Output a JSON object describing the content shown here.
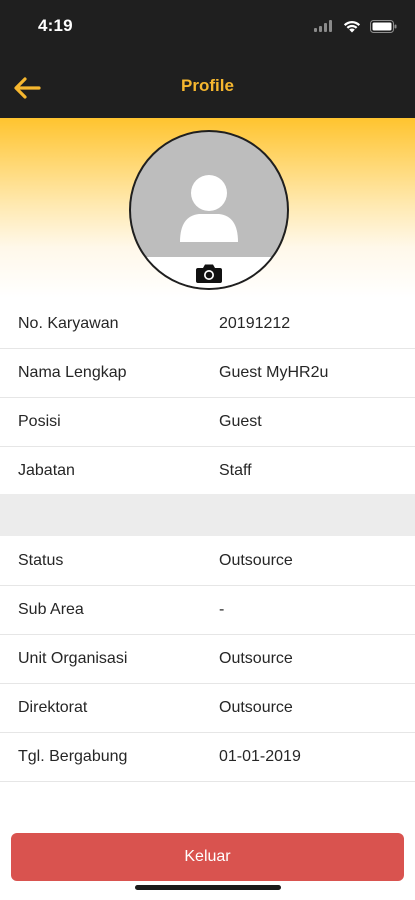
{
  "status_bar": {
    "time": "4:19",
    "icons": [
      "signal-icon",
      "wifi-icon",
      "battery-icon"
    ]
  },
  "nav": {
    "title": "Profile",
    "back_icon": "arrow-left-icon",
    "accent_color": "#f6b72f"
  },
  "profile": {
    "avatar_icon": "person-placeholder-icon",
    "camera_icon": "camera-icon"
  },
  "section_1": {
    "rows": [
      {
        "label": "No. Karyawan",
        "value": "20191212"
      },
      {
        "label": "Nama Lengkap",
        "value": "Guest MyHR2u"
      },
      {
        "label": "Posisi",
        "value": "Guest"
      },
      {
        "label": "Jabatan",
        "value": "Staff"
      }
    ]
  },
  "section_2": {
    "rows": [
      {
        "label": "Status",
        "value": "Outsource"
      },
      {
        "label": "Sub Area",
        "value": "-"
      },
      {
        "label": "Unit Organisasi",
        "value": "Outsource"
      },
      {
        "label": "Direktorat",
        "value": "Outsource"
      },
      {
        "label": "Tgl. Bergabung",
        "value": "01-01-2019"
      }
    ]
  },
  "logout": {
    "label": "Keluar",
    "color": "#d9534f"
  },
  "colors": {
    "header_bg": "#1f1f1f",
    "gradient_top": "#ffc42f"
  }
}
